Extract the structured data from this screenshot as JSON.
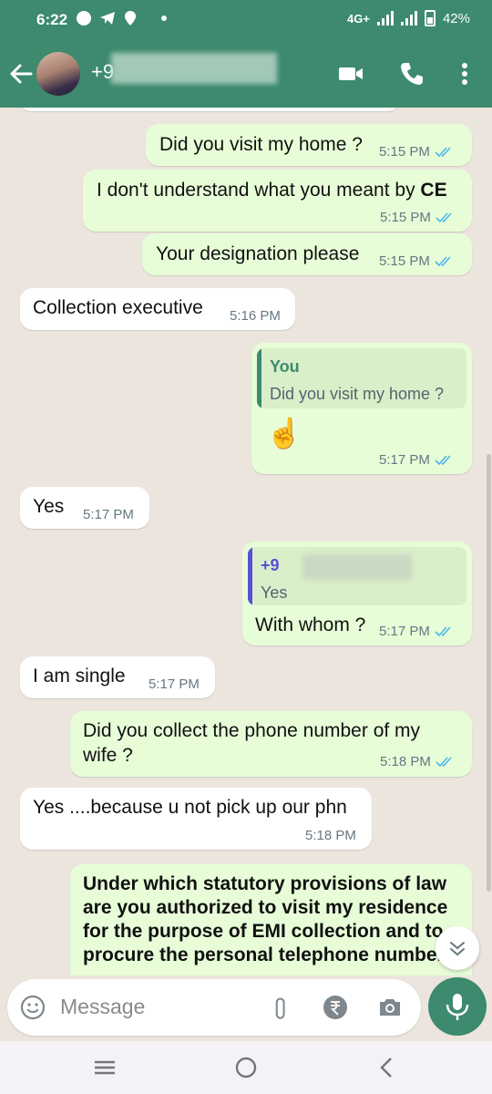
{
  "status_bar": {
    "time": "6:22",
    "network": "4G+",
    "battery": "42%"
  },
  "header": {
    "contact_name": "+9",
    "back_icon": "arrow-left-icon",
    "video_icon": "video-call-icon",
    "call_icon": "phone-icon",
    "menu_icon": "more-vertical-icon"
  },
  "messages": [
    {
      "type": "out",
      "text": "Did you visit my home ?",
      "time": "5:15 PM"
    },
    {
      "type": "out",
      "text": "I don't understand what you meant by ",
      "bold": "CE",
      "time": "5:15 PM"
    },
    {
      "type": "out",
      "text": "Your designation please",
      "time": "5:15 PM"
    },
    {
      "type": "in",
      "text": "Collection executive",
      "time": "5:16 PM"
    },
    {
      "type": "out",
      "quote_name": "You",
      "quote_text": "Did you visit my home ?",
      "text": "☝️",
      "time": "5:17 PM"
    },
    {
      "type": "in",
      "text": "Yes",
      "time": "5:17 PM"
    },
    {
      "type": "out",
      "quote_name": "+9",
      "quote_text": "Yes",
      "text": "With whom ?",
      "time": "5:17 PM"
    },
    {
      "type": "in",
      "text": "I am single",
      "time": "5:17 PM"
    },
    {
      "type": "out",
      "line1": "Did you collect the phone number of my",
      "line2": "wife ?",
      "time": "5:18 PM"
    },
    {
      "type": "in",
      "text": "Yes ....because u not pick up our phn",
      "time": "5:18 PM"
    },
    {
      "type": "out",
      "line1": "Under which statutory provisions of law",
      "line2": "are you authorized to visit my residence",
      "line3": "for the purpose of EMI collection and to",
      "line4": "procure the personal telephone number"
    }
  ],
  "input": {
    "placeholder": "Message"
  },
  "colors": {
    "header": "#3d8a6e",
    "outgoing_bubble": "#e7fdd8",
    "incoming_bubble": "#ffffff",
    "read_tick": "#4fb6ec",
    "quote_you": "#3d8a6e",
    "quote_contact": "#5a4fd6"
  }
}
